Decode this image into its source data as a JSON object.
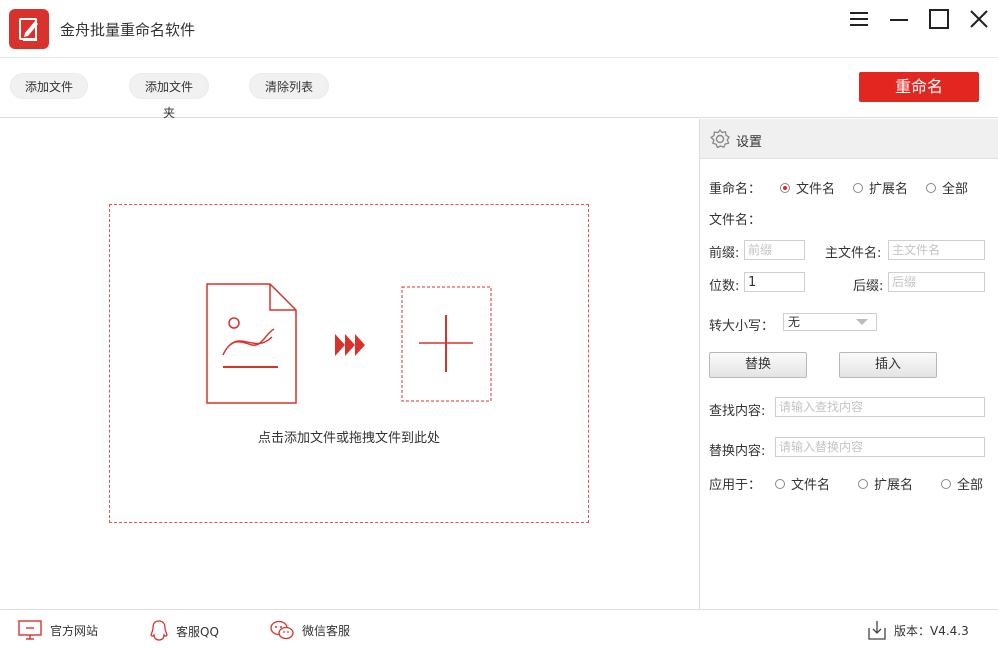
{
  "app": {
    "title": "金舟批量重命名软件"
  },
  "toolbar": {
    "add_file": "添加文件",
    "add_folder": "添加文件夹",
    "clear_list": "清除列表",
    "rename": "重命名"
  },
  "dropzone": {
    "hint": "点击添加文件或拖拽文件到此处"
  },
  "settings": {
    "header": "设置",
    "rename_label": "重命名：",
    "rename_options": [
      "文件名",
      "扩展名",
      "全部"
    ],
    "rename_selected": 0,
    "filename_label": "文件名：",
    "prefix_label": "前缀:",
    "prefix_placeholder": "前缀",
    "mainname_label": "主文件名:",
    "mainname_placeholder": "主文件名",
    "digits_label": "位数:",
    "digits_value": "1",
    "suffix_label": "后缀:",
    "suffix_placeholder": "后缀",
    "case_label": "转大小写：",
    "case_value": "无",
    "replace_btn": "替换",
    "insert_btn": "插入",
    "find_label": "查找内容:",
    "find_placeholder": "请输入查找内容",
    "replace_label": "替换内容:",
    "replace_placeholder": "请输入替换内容",
    "apply_label": "应用于：",
    "apply_options": [
      "文件名",
      "扩展名",
      "全部"
    ]
  },
  "status": {
    "website": "官方网站",
    "qq": "客服QQ",
    "wechat": "微信客服",
    "version": "版本：V4.4.3"
  },
  "colors": {
    "accent": "#e1271f",
    "dash": "#e05250"
  }
}
